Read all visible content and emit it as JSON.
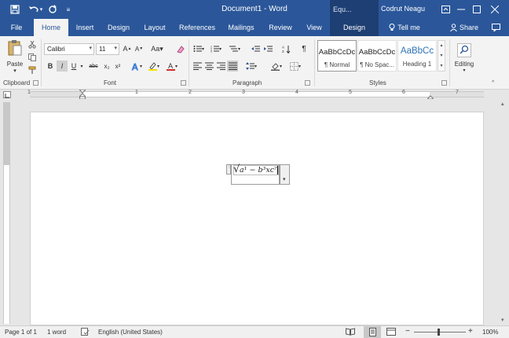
{
  "titlebar": {
    "title": "Document1  -  Word",
    "context_group": "Equ...",
    "user": "Codrut Neagu",
    "save_icon": "save-icon",
    "undo_icon": "undo-icon",
    "redo_icon": "redo-icon",
    "customize_icon": "customize-qat-icon",
    "ribbon_display_icon": "ribbon-display-options-icon",
    "minimize_icon": "minimize-icon",
    "maximize_icon": "maximize-icon",
    "close_icon": "close-icon"
  },
  "tabs": {
    "file": "File",
    "home": "Home",
    "insert": "Insert",
    "design": "Design",
    "layout": "Layout",
    "references": "References",
    "mailings": "Mailings",
    "review": "Review",
    "view": "View",
    "eq_design": "Design",
    "tell_me": "Tell me",
    "share": "Share"
  },
  "ribbon": {
    "clipboard": {
      "label": "Clipboard",
      "paste": "Paste"
    },
    "font": {
      "label": "Font",
      "font_name": "Calibri",
      "font_size": "11",
      "bold": "B",
      "italic": "I",
      "underline": "U",
      "strike": "abc",
      "subscript": "x₂",
      "superscript": "x²"
    },
    "paragraph": {
      "label": "Paragraph"
    },
    "styles": {
      "label": "Styles",
      "items": [
        {
          "preview": "AaBbCcDc",
          "name": "¶ Normal"
        },
        {
          "preview": "AaBbCcDc",
          "name": "¶ No Spac..."
        },
        {
          "preview": "AaBbCc",
          "name": "Heading 1"
        }
      ]
    },
    "editing": {
      "label": "Editing"
    }
  },
  "ruler": {
    "numbers": [
      "1",
      "1",
      "2",
      "3",
      "4",
      "5",
      "6",
      "7"
    ]
  },
  "equation": {
    "radical": "√",
    "text": "a¹ − b³xc⁷"
  },
  "status": {
    "page": "Page 1 of 1",
    "words": "1 word",
    "language": "English (United States)",
    "zoom": "100%",
    "zoom_minus": "−",
    "zoom_plus": "+"
  }
}
